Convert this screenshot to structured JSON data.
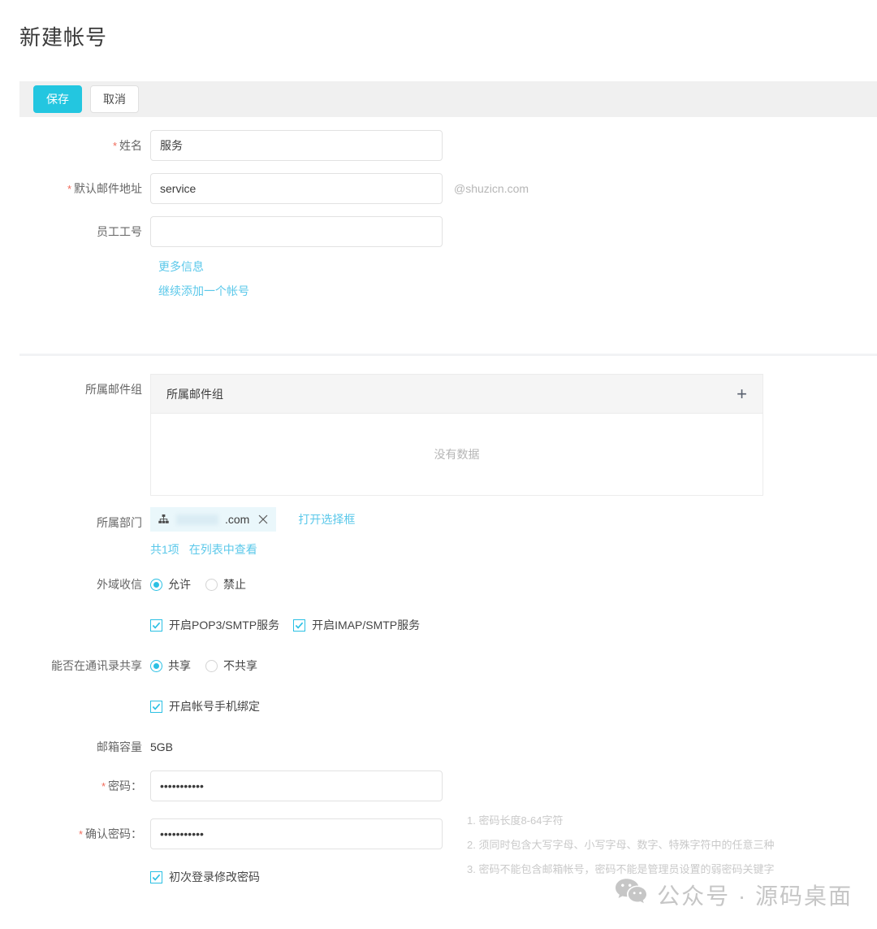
{
  "page": {
    "title": "新建帐号"
  },
  "toolbar": {
    "save_label": "保存",
    "cancel_label": "取消",
    "primary_color": "#23c6e0"
  },
  "basic_form": {
    "name": {
      "label": "姓名",
      "required": true,
      "value": "服务",
      "placeholder": ""
    },
    "default_mail": {
      "label": "默认邮件地址",
      "required": true,
      "value": "service",
      "placeholder": "",
      "domain_suffix": "@shuzicn.com"
    },
    "employee_no": {
      "label": "员工工号",
      "required": false,
      "value": "",
      "placeholder": ""
    },
    "more_info_link": "更多信息",
    "add_another_link": "继续添加一个帐号"
  },
  "mail_group": {
    "label": "所属邮件组",
    "panel_header": "所属邮件组",
    "add_icon": "plus-icon",
    "empty_text": "没有数据"
  },
  "department": {
    "label": "所属部门",
    "chip": {
      "icon": "sitemap-icon",
      "text": ".com",
      "close_icon": "close-icon"
    },
    "open_picker_link": "打开选择框",
    "count_link": "共1项",
    "view_in_list_link": "在列表中查看"
  },
  "external_receive": {
    "label": "外域收信",
    "options": [
      {
        "label": "允许",
        "selected": true
      },
      {
        "label": "禁止",
        "selected": false
      }
    ],
    "protocols": [
      {
        "label": "开启POP3/SMTP服务",
        "checked": true
      },
      {
        "label": "开启IMAP/SMTP服务",
        "checked": true
      }
    ]
  },
  "contact_share": {
    "label": "能否在通讯录共享",
    "options": [
      {
        "label": "共享",
        "selected": true
      },
      {
        "label": "不共享",
        "selected": false
      }
    ],
    "phone_bind": {
      "label": "开启帐号手机绑定",
      "checked": true
    }
  },
  "mailbox_capacity": {
    "label": "邮箱容量",
    "value": "5GB"
  },
  "password": {
    "label": "密码：",
    "required": true,
    "value": "•••••••••••",
    "placeholder": ""
  },
  "confirm_password": {
    "label": "确认密码：",
    "required": true,
    "value": "•••••••••••",
    "placeholder": ""
  },
  "first_login_change": {
    "label": "初次登录修改密码",
    "checked": true
  },
  "password_hints": [
    "1. 密码长度8-64字符",
    "2. 须同时包含大写字母、小写字母、数字、特殊字符中的任意三种",
    "3. 密码不能包含邮箱帐号，密码不能是管理员设置的弱密码关键字"
  ],
  "watermark": {
    "icon": "wechat-icon",
    "text": "公众号 · 源码桌面"
  }
}
